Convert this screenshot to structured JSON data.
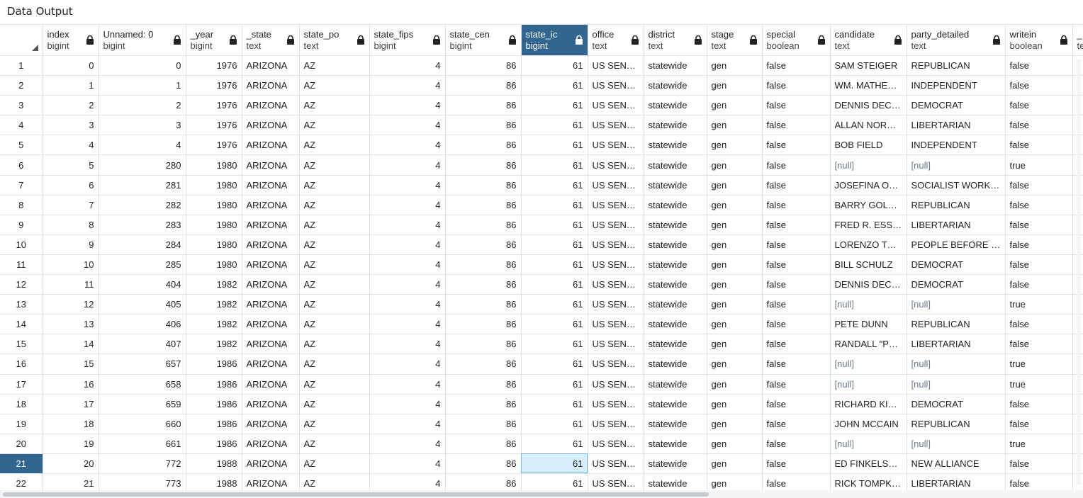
{
  "panel": {
    "title": "Data Output"
  },
  "colors": {
    "selected_header": "#326690",
    "active_cell": "#d6eefa",
    "null_text": "#6b7a8c"
  },
  "columns": [
    {
      "name": "index",
      "type": "bigint",
      "align": "num",
      "width": 79
    },
    {
      "name": "Unnamed: 0",
      "type": "bigint",
      "align": "num",
      "width": 123
    },
    {
      "name": "_year",
      "type": "bigint",
      "align": "num",
      "width": 79
    },
    {
      "name": "_state",
      "type": "text",
      "align": "txt",
      "width": 81
    },
    {
      "name": "state_po",
      "type": "text",
      "align": "txt",
      "width": 99
    },
    {
      "name": "state_fips",
      "type": "bigint",
      "align": "num",
      "width": 107
    },
    {
      "name": "state_cen",
      "type": "bigint",
      "align": "num",
      "width": 107
    },
    {
      "name": "state_ic",
      "type": "bigint",
      "align": "num",
      "width": 94
    },
    {
      "name": "office",
      "type": "text",
      "align": "txt",
      "width": 79
    },
    {
      "name": "district",
      "type": "text",
      "align": "txt",
      "width": 89
    },
    {
      "name": "stage",
      "type": "text",
      "align": "txt",
      "width": 78
    },
    {
      "name": "special",
      "type": "boolean",
      "align": "txt",
      "width": 96
    },
    {
      "name": "candidate",
      "type": "text",
      "align": "txt",
      "width": 108
    },
    {
      "name": "party_detailed",
      "type": "text",
      "align": "txt",
      "width": 139
    },
    {
      "name": "writein",
      "type": "boolean",
      "align": "txt",
      "width": 95
    },
    {
      "name": "_",
      "type": "te",
      "align": "txt",
      "width": 33
    }
  ],
  "rows": [
    {
      "n": "1",
      "c": [
        "0",
        "0",
        "1976",
        "ARIZONA",
        "AZ",
        "4",
        "86",
        "61",
        "US SENATE",
        "statewide",
        "gen",
        "false",
        "SAM STEIGER",
        "REPUBLICAN",
        "false",
        ""
      ]
    },
    {
      "n": "2",
      "c": [
        "1",
        "1",
        "1976",
        "ARIZONA",
        "AZ",
        "4",
        "86",
        "61",
        "US SENATE",
        "statewide",
        "gen",
        "false",
        "WM. MATHEWS FEIGHAN",
        "INDEPENDENT",
        "false",
        ""
      ]
    },
    {
      "n": "3",
      "c": [
        "2",
        "2",
        "1976",
        "ARIZONA",
        "AZ",
        "4",
        "86",
        "61",
        "US SENATE",
        "statewide",
        "gen",
        "false",
        "DENNIS DECONCINI",
        "DEMOCRAT",
        "false",
        ""
      ]
    },
    {
      "n": "4",
      "c": [
        "3",
        "3",
        "1976",
        "ARIZONA",
        "AZ",
        "4",
        "86",
        "61",
        "US SENATE",
        "statewide",
        "gen",
        "false",
        "ALLAN NORWITZ",
        "LIBERTARIAN",
        "false",
        ""
      ]
    },
    {
      "n": "5",
      "c": [
        "4",
        "4",
        "1976",
        "ARIZONA",
        "AZ",
        "4",
        "86",
        "61",
        "US SENATE",
        "statewide",
        "gen",
        "false",
        "BOB FIELD",
        "INDEPENDENT",
        "false",
        ""
      ]
    },
    {
      "n": "6",
      "c": [
        "5",
        "280",
        "1980",
        "ARIZONA",
        "AZ",
        "4",
        "86",
        "61",
        "US SENATE",
        "statewide",
        "gen",
        "false",
        "[null]",
        "[null]",
        "true",
        ""
      ]
    },
    {
      "n": "7",
      "c": [
        "6",
        "281",
        "1980",
        "ARIZONA",
        "AZ",
        "4",
        "86",
        "61",
        "US SENATE",
        "statewide",
        "gen",
        "false",
        "JOSEFINA OTERO",
        "SOCIALIST WORKERS",
        "false",
        ""
      ]
    },
    {
      "n": "8",
      "c": [
        "7",
        "282",
        "1980",
        "ARIZONA",
        "AZ",
        "4",
        "86",
        "61",
        "US SENATE",
        "statewide",
        "gen",
        "false",
        "BARRY GOLDWATER",
        "REPUBLICAN",
        "false",
        ""
      ]
    },
    {
      "n": "9",
      "c": [
        "8",
        "283",
        "1980",
        "ARIZONA",
        "AZ",
        "4",
        "86",
        "61",
        "US SENATE",
        "statewide",
        "gen",
        "false",
        "FRED R. ESSER",
        "LIBERTARIAN",
        "false",
        ""
      ]
    },
    {
      "n": "10",
      "c": [
        "9",
        "284",
        "1980",
        "ARIZONA",
        "AZ",
        "4",
        "86",
        "61",
        "US SENATE",
        "statewide",
        "gen",
        "false",
        "LORENZO TORREZ",
        "PEOPLE BEFORE PROFITS",
        "false",
        ""
      ]
    },
    {
      "n": "11",
      "c": [
        "10",
        "285",
        "1980",
        "ARIZONA",
        "AZ",
        "4",
        "86",
        "61",
        "US SENATE",
        "statewide",
        "gen",
        "false",
        "BILL SCHULZ",
        "DEMOCRAT",
        "false",
        ""
      ]
    },
    {
      "n": "12",
      "c": [
        "11",
        "404",
        "1982",
        "ARIZONA",
        "AZ",
        "4",
        "86",
        "61",
        "US SENATE",
        "statewide",
        "gen",
        "false",
        "DENNIS DECONCINI",
        "DEMOCRAT",
        "false",
        ""
      ]
    },
    {
      "n": "13",
      "c": [
        "12",
        "405",
        "1982",
        "ARIZONA",
        "AZ",
        "4",
        "86",
        "61",
        "US SENATE",
        "statewide",
        "gen",
        "false",
        "[null]",
        "[null]",
        "true",
        ""
      ]
    },
    {
      "n": "14",
      "c": [
        "13",
        "406",
        "1982",
        "ARIZONA",
        "AZ",
        "4",
        "86",
        "61",
        "US SENATE",
        "statewide",
        "gen",
        "false",
        "PETE DUNN",
        "REPUBLICAN",
        "false",
        ""
      ]
    },
    {
      "n": "15",
      "c": [
        "14",
        "407",
        "1982",
        "ARIZONA",
        "AZ",
        "4",
        "86",
        "61",
        "US SENATE",
        "statewide",
        "gen",
        "false",
        "RANDALL \"PETE\" DAY",
        "LIBERTARIAN",
        "false",
        ""
      ]
    },
    {
      "n": "16",
      "c": [
        "15",
        "657",
        "1986",
        "ARIZONA",
        "AZ",
        "4",
        "86",
        "61",
        "US SENATE",
        "statewide",
        "gen",
        "false",
        "[null]",
        "[null]",
        "true",
        ""
      ]
    },
    {
      "n": "17",
      "c": [
        "16",
        "658",
        "1986",
        "ARIZONA",
        "AZ",
        "4",
        "86",
        "61",
        "US SENATE",
        "statewide",
        "gen",
        "false",
        "[null]",
        "[null]",
        "true",
        ""
      ]
    },
    {
      "n": "18",
      "c": [
        "17",
        "659",
        "1986",
        "ARIZONA",
        "AZ",
        "4",
        "86",
        "61",
        "US SENATE",
        "statewide",
        "gen",
        "false",
        "RICHARD KIMBALL",
        "DEMOCRAT",
        "false",
        ""
      ]
    },
    {
      "n": "19",
      "c": [
        "18",
        "660",
        "1986",
        "ARIZONA",
        "AZ",
        "4",
        "86",
        "61",
        "US SENATE",
        "statewide",
        "gen",
        "false",
        "JOHN MCCAIN",
        "REPUBLICAN",
        "false",
        ""
      ]
    },
    {
      "n": "20",
      "c": [
        "19",
        "661",
        "1986",
        "ARIZONA",
        "AZ",
        "4",
        "86",
        "61",
        "US SENATE",
        "statewide",
        "gen",
        "false",
        "[null]",
        "[null]",
        "true",
        ""
      ]
    },
    {
      "n": "21",
      "c": [
        "20",
        "772",
        "1988",
        "ARIZONA",
        "AZ",
        "4",
        "86",
        "61",
        "US SENATE",
        "statewide",
        "gen",
        "false",
        "ED FINKELSTEIN",
        "NEW ALLIANCE",
        "false",
        ""
      ]
    },
    {
      "n": "22",
      "c": [
        "21",
        "773",
        "1988",
        "ARIZONA",
        "AZ",
        "4",
        "86",
        "61",
        "US SENATE",
        "statewide",
        "gen",
        "false",
        "RICK TOMPKINS",
        "LIBERTARIAN",
        "false",
        ""
      ]
    }
  ],
  "selection": {
    "column": "state_ic",
    "row": "21"
  }
}
